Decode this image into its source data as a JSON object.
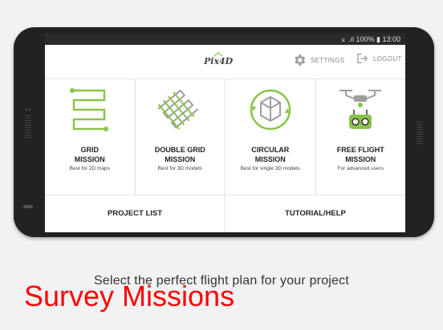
{
  "status_bar": {
    "text": "⌅ .ıl 100% ▮ 13:00"
  },
  "header": {
    "logo": "Pix4D",
    "settings_label": "SETTINGS",
    "logout_label": "LOGOUT"
  },
  "missions": [
    {
      "line1": "GRID",
      "line2": "MISSION",
      "subtitle": "Best for 2D maps"
    },
    {
      "line1": "DOUBLE GRID",
      "line2": "MISSION",
      "subtitle": "Best for 3D models"
    },
    {
      "line1": "CIRCULAR",
      "line2": "MISSION",
      "subtitle": "Best for single 3D models"
    },
    {
      "line1": "FREE FLIGHT",
      "line2": "MISSION",
      "subtitle": "For advanced users"
    }
  ],
  "bottom_buttons": {
    "project_list": "PROJECT LIST",
    "tutorial_help": "TUTORIAL/HELP"
  },
  "tagline": "Select the perfect flight plan for your project",
  "overlay_title": "Survey Missions",
  "colors": {
    "accent_green": "#8bc34a",
    "icon_gray": "#9e9e9e",
    "overlay_red": "#ff0000"
  },
  "icons": [
    "gear-icon",
    "logout-icon",
    "grid-path-icon",
    "double-grid-icon",
    "circular-cube-icon",
    "drone-controller-icon"
  ]
}
